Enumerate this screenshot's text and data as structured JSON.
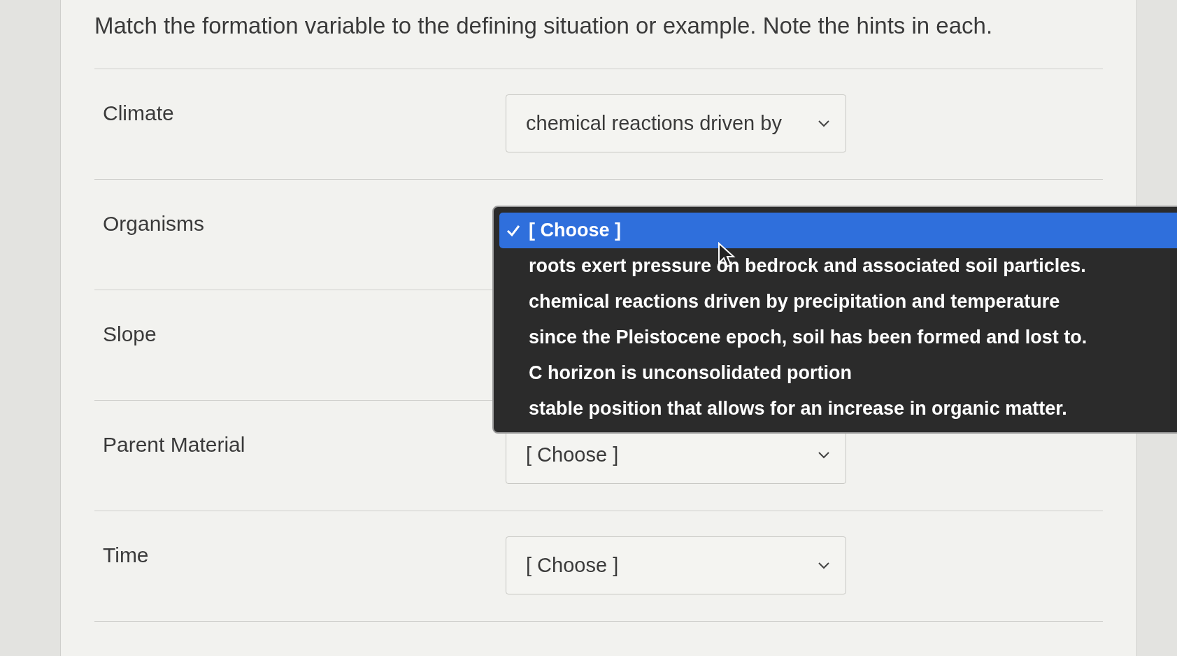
{
  "question": "Match the formation variable to the defining situation or example. Note the hints in each.",
  "rows": [
    {
      "label": "Climate",
      "select": {
        "value": "chemical reactions driven by"
      }
    },
    {
      "label": "Organisms",
      "menu": {
        "options": [
          {
            "label": "[ Choose ]",
            "selected": true
          },
          {
            "label": "roots exert pressure on bedrock and associated soil particles.",
            "selected": false
          },
          {
            "label": "chemical reactions driven by precipitation and temperature",
            "selected": false
          },
          {
            "label": "since the Pleistocene epoch, soil has been formed and lost to.",
            "selected": false
          },
          {
            "label": "C horizon is unconsolidated portion",
            "selected": false
          },
          {
            "label": "stable position that allows for an increase in organic matter.",
            "selected": false
          }
        ]
      }
    },
    {
      "label": "Slope"
    },
    {
      "label": "Parent Material",
      "select": {
        "value": "[ Choose ]"
      }
    },
    {
      "label": "Time",
      "select": {
        "value": "[ Choose ]"
      }
    }
  ]
}
